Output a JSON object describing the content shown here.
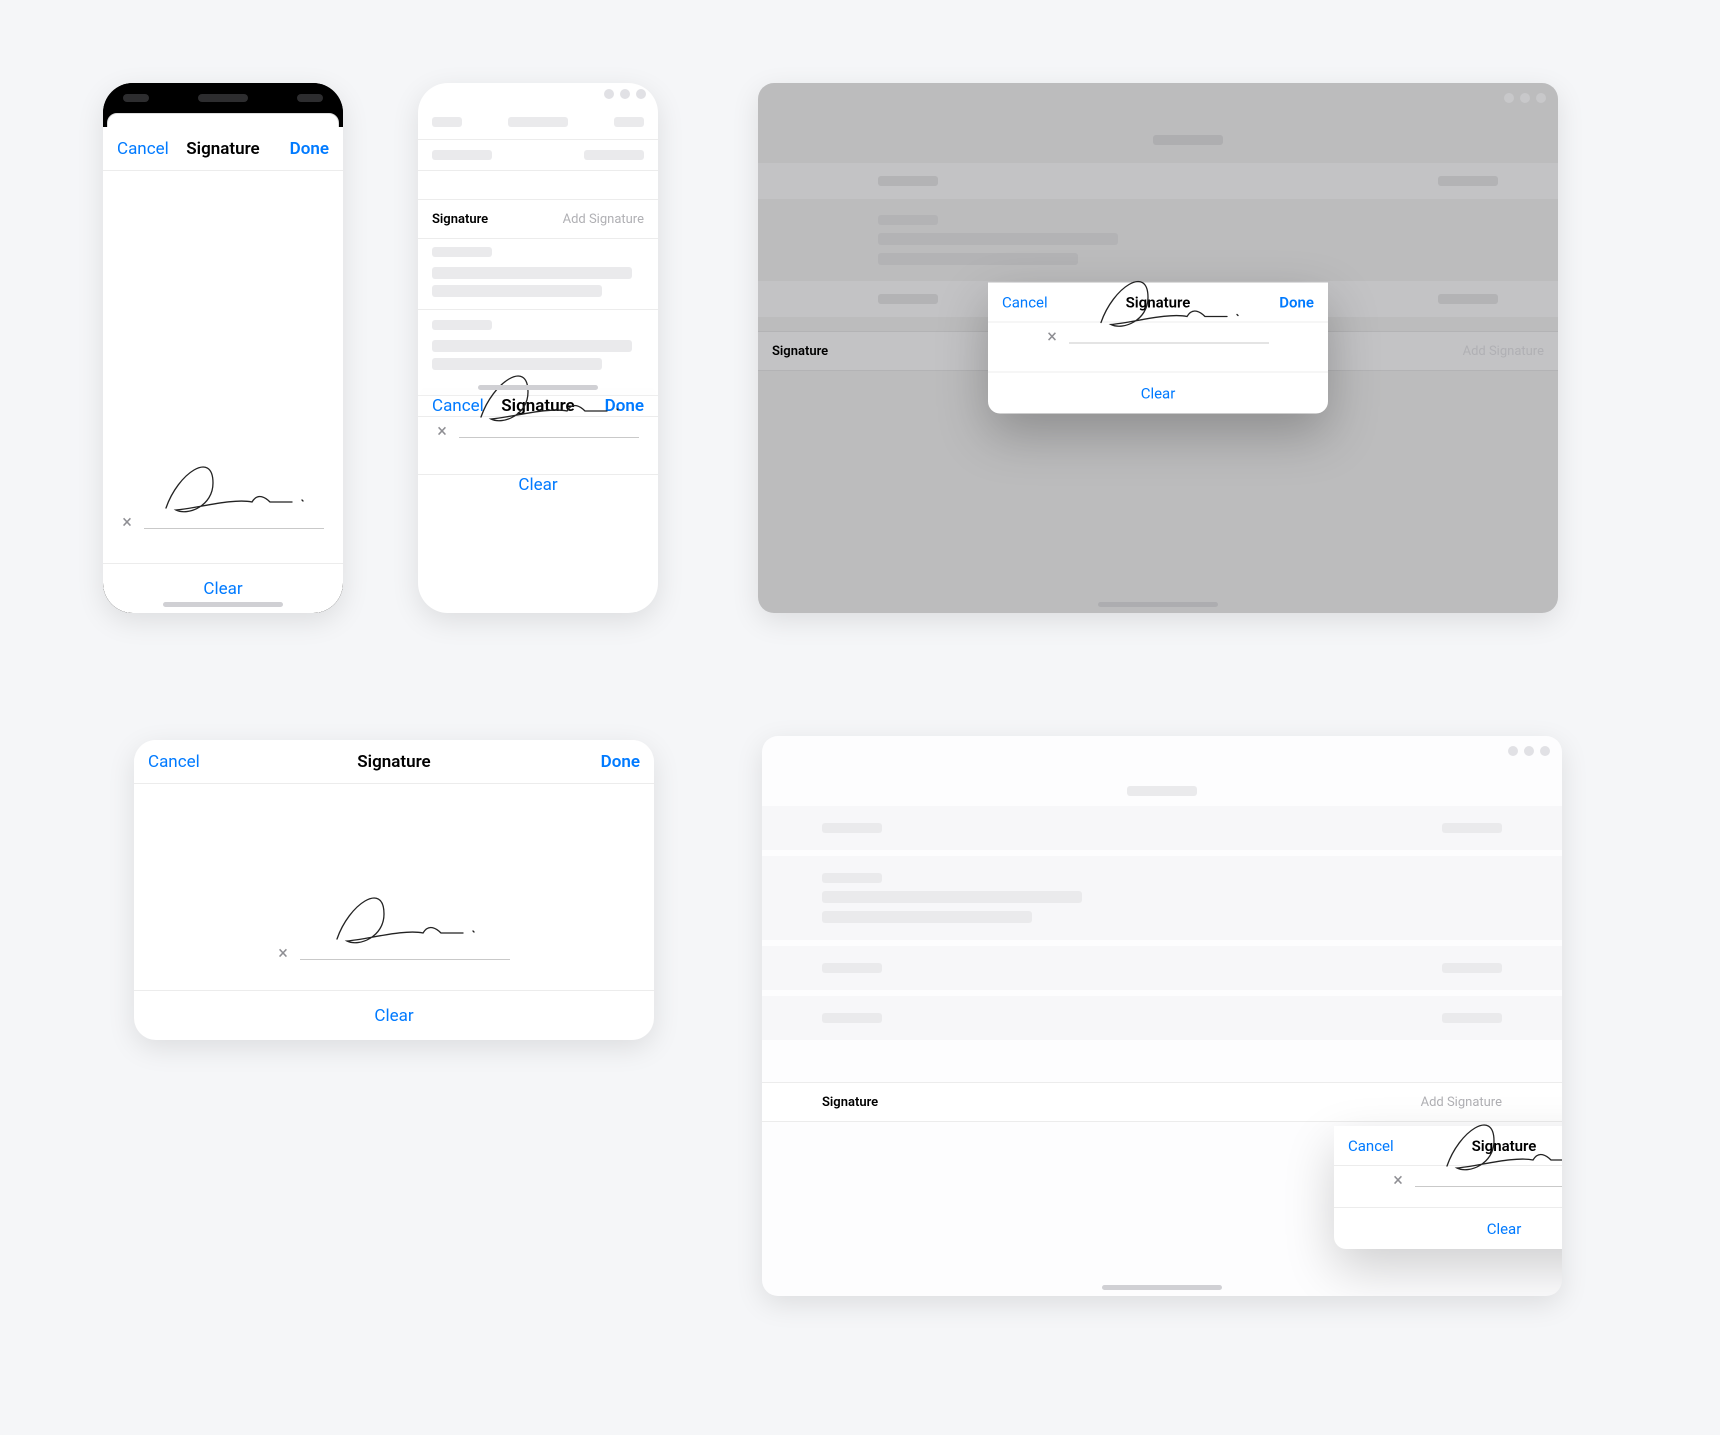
{
  "common": {
    "cancel": "Cancel",
    "done": "Done",
    "clear": "Clear",
    "signature_title": "Signature"
  },
  "sig_row": {
    "label": "Signature",
    "placeholder": "Add Signature"
  },
  "colors": {
    "accent": "#007aff",
    "text": "#000000",
    "muted": "#8e8e93",
    "ghost": "#b0b0b4",
    "divider": "#ececec",
    "page_bg": "#f5f6f8",
    "dim_bg": "#bcbcbd"
  },
  "devices": {
    "d1": {
      "variant": "iphone-fullscreen-sheet"
    },
    "d2": {
      "variant": "iphone-inline-half-sheet"
    },
    "d3": {
      "variant": "ipad-modal-dimmed"
    },
    "d4": {
      "variant": "iphone-landscape-fullwidth"
    },
    "d5": {
      "variant": "ipad-popover"
    }
  }
}
